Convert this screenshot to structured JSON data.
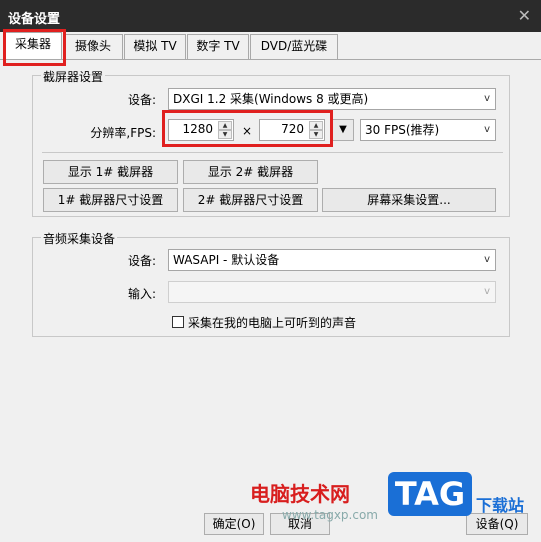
{
  "window": {
    "title": "设备设置",
    "close_glyph": "✕"
  },
  "tabs": [
    "采集器",
    "摄像头",
    "模拟 TV",
    "数字 TV",
    "DVD/蓝光碟"
  ],
  "screen_capture": {
    "group_title": "截屏器设置",
    "device_label": "设备:",
    "device_value": "DXGI 1.2 采集(Windows 8 或更高)",
    "resolution_label": "分辨率,FPS:",
    "width_value": "1280",
    "times_glyph": "×",
    "height_value": "720",
    "preset_glyph": "▼",
    "fps_value": "30 FPS(推荐)",
    "buttons": {
      "show1": "显示 1# 截屏器",
      "show2": "显示 2# 截屏器",
      "size1": "1# 截屏器尺寸设置",
      "size2": "2# 截屏器尺寸设置",
      "screen_settings": "屏幕采集设置..."
    }
  },
  "audio_capture": {
    "group_title": "音频采集设备",
    "device_label": "设备:",
    "device_value": "WASAPI - 默认设备",
    "input_label": "输入:",
    "input_value": "",
    "checkbox_label": "采集在我的电脑上可听到的声音"
  },
  "footer": {
    "ok_label": "确定(O)",
    "cancel_label": "取消",
    "settings_label": "设备(Q)"
  },
  "watermark": {
    "site_name": "电脑技术网",
    "url": "www.tagxp.com",
    "logo": "TAG",
    "download": "下载站"
  }
}
